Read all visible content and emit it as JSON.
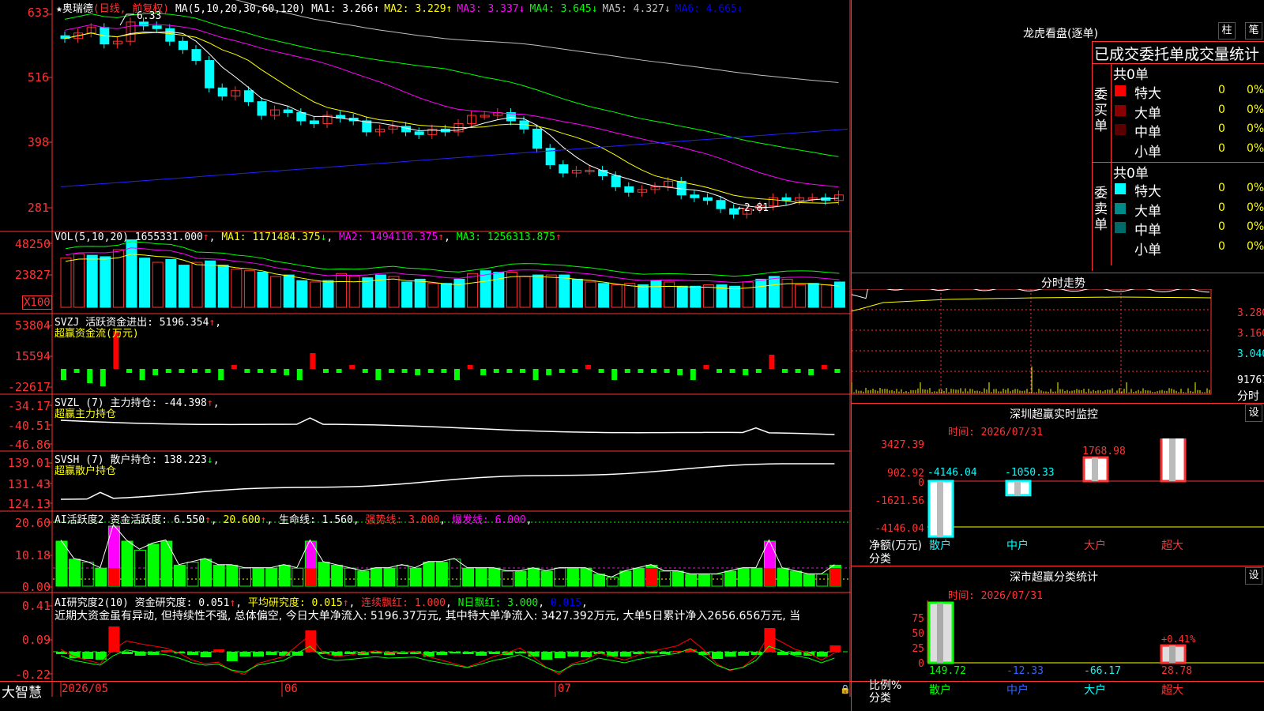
{
  "stock": {
    "name": "★奥瑞德",
    "period": "(日线, 前复权)",
    "ma_label": "MA(5,10,20,30,60,120)",
    "ma": [
      {
        "label": "MA1:",
        "value": "3.266",
        "arrow": "↑",
        "color": "#ffffff"
      },
      {
        "label": "MA2:",
        "value": "3.229",
        "arrow": "↑",
        "color": "#ffff00"
      },
      {
        "label": "MA3:",
        "value": "3.337",
        "arrow": "↓",
        "color": "#ff00ff"
      },
      {
        "label": "MA4:",
        "value": "3.645",
        "arrow": "↓",
        "color": "#00ff00"
      },
      {
        "label": "MA5:",
        "value": "4.327",
        "arrow": "↓",
        "color": "#c0c0c0"
      },
      {
        "label": "MA6:",
        "value": "4.665",
        "arrow": "↓",
        "color": "#0000ff"
      }
    ],
    "high_note": "6.33",
    "low_note": "←2.81"
  },
  "price_axis": [
    "633",
    "516",
    "398",
    "281"
  ],
  "vol": {
    "label": "VOL(5,10,20)",
    "value": "1655331.000",
    "ma1": "MA1: 1171484.375",
    "ma2": "MA2: 1494110.375",
    "ma3": "MA3: 1256313.875",
    "axis": [
      "48250",
      "23827"
    ],
    "unit": "X100"
  },
  "svzj": {
    "label": "SVZJ  活跃资金进出: 5196.354",
    "sub": "超赢资金流(万元)",
    "axis": [
      "53804",
      "15594",
      "-22617"
    ]
  },
  "svzl": {
    "label": "SVZL (7) 主力持仓: -44.398",
    "sub": "超赢主力持仓",
    "axis": [
      "-34.17",
      "-40.51",
      "-46.86"
    ]
  },
  "svsh": {
    "label": "SVSH (7) 散户持仓: 138.223",
    "sub": "超赢散户持仓",
    "axis": [
      "139.01",
      "131.43",
      "124.13"
    ]
  },
  "ai1": {
    "label": "AI活跃度2 资金活跃度: 6.550",
    "v2": "20.600",
    "life": "生命线: 1.560",
    "strong": "强势线: 3.000",
    "burst": "爆发线: 6.000",
    "axis": [
      "20.60",
      "10.18",
      "0.00"
    ]
  },
  "ai2": {
    "label": "AI研究度2(10) 资金研究度: 0.051",
    "avg": "平均研究度: 0.015",
    "lx": "连续飘红: 1.000",
    "nr": "N日飘红: 3.000",
    "last": "0.015",
    "comment": "近期大资金虽有异动, 但持续性不强, 总体偏空, 今日大单净流入: 5196.37万元, 其中特大单净流入: 3427.392万元, 大单5日累计净入2656.656万元, 当",
    "axis": [
      "0.41",
      "0.09",
      "-0.22"
    ]
  },
  "bottom": {
    "brand": "大智慧",
    "dates": [
      "2026/05",
      "06",
      "07"
    ]
  },
  "dragon": {
    "title": "龙虎看盘(逐单)",
    "btn1": "柱",
    "btn2": "笔",
    "header": "已成交委托单成交量统计",
    "buy_label": "委买单",
    "sell_label": "委卖单",
    "buy_total": "共0单",
    "sell_total": "共0单",
    "buy_rows": [
      {
        "name": "特大",
        "count": "0",
        "pct": "0%",
        "color": "#ff0000"
      },
      {
        "name": "大单",
        "count": "0",
        "pct": "0%",
        "color": "#8b0000"
      },
      {
        "name": "中单",
        "count": "0",
        "pct": "0%",
        "color": "#5a0000"
      },
      {
        "name": "小单",
        "count": "0",
        "pct": "0%",
        "color": "#000000"
      }
    ],
    "sell_rows": [
      {
        "name": "特大",
        "count": "0",
        "pct": "0%",
        "color": "#00ffff"
      },
      {
        "name": "大单",
        "count": "0",
        "pct": "0%",
        "color": "#008b8b"
      },
      {
        "name": "中单",
        "count": "0",
        "pct": "0%",
        "color": "#006a6a"
      },
      {
        "name": "小单",
        "count": "0",
        "pct": "0%",
        "color": "#000000"
      }
    ]
  },
  "intraday": {
    "title": "分时走势",
    "axis": [
      "3.280",
      "3.160",
      "3.040"
    ],
    "vol_label": "91767",
    "unit": "分时"
  },
  "monitor": {
    "title": "深圳超赢实时监控",
    "btn": "设",
    "time": "时间: 2026/07/31",
    "axis": [
      "3427.39",
      "902.92",
      "0",
      "-1621.56",
      "-4146.04"
    ],
    "unit_label": "净额(万元)",
    "cat_label": "分类",
    "values": [
      "-4146.04",
      "-1050.33",
      "1768.98",
      "3427.39"
    ],
    "categories": [
      "散户",
      "中户",
      "大户",
      "超大"
    ],
    "colors": [
      "#00ffff",
      "#00ffff",
      "#ff3333",
      "#ff3333"
    ]
  },
  "stats": {
    "title": "深市超赢分类统计",
    "btn": "设",
    "time": "时间: 2026/07/31",
    "axis": [
      "75",
      "50",
      "25",
      "0"
    ],
    "unit_label": "比例%",
    "cat_label": "分类",
    "values": [
      "149.72",
      "-12.33",
      "-66.17",
      "28.78"
    ],
    "pct_note": "+0.41%",
    "categories": [
      "散户",
      "中户",
      "大户",
      "超大"
    ],
    "colors": [
      "#00ff00",
      "#3366ff",
      "#00ffff",
      "#ff3333"
    ]
  }
}
